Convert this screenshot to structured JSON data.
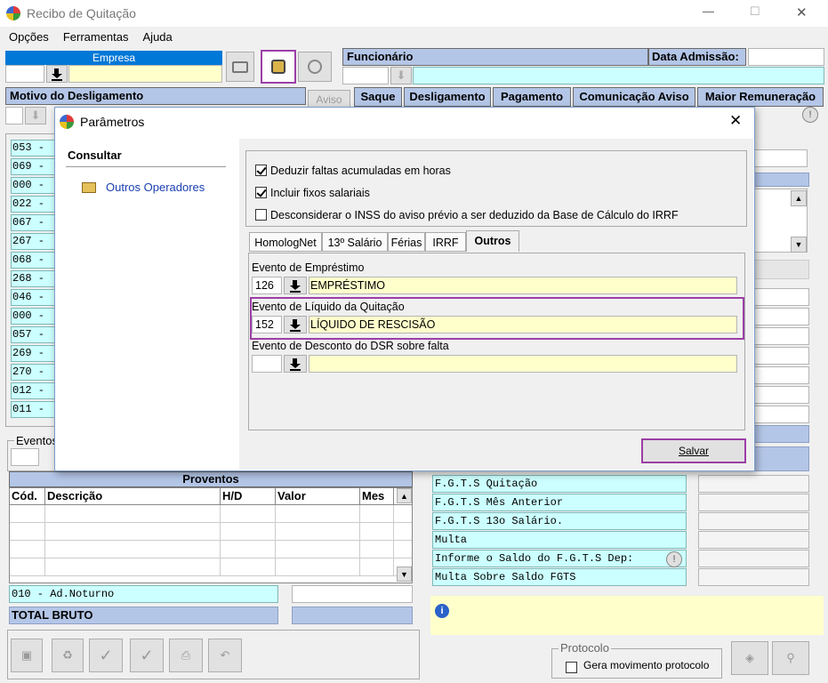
{
  "window": {
    "title": "Recibo de Quitação",
    "minimize": "—",
    "maximize": "☐",
    "close": "✕"
  },
  "menu": [
    "Opções",
    "Ferramentas",
    "Ajuda"
  ],
  "empresa": {
    "label": "Empresa"
  },
  "funcionario": {
    "label": "Funcionário",
    "admissao_label": "Data Admissão:"
  },
  "motivo": {
    "label": "Motivo do Desligamento",
    "aviso": "Aviso"
  },
  "tabs_top": [
    "Saque",
    "Desligamento",
    "Pagamento",
    "Comunicação Aviso",
    "Maior Remuneração"
  ],
  "left_codes": [
    "053 -",
    "069 -",
    "000 -",
    "022 -",
    "067 -",
    "267 -",
    "068 -",
    "268 -",
    "046 -",
    "000 -",
    "057 -",
    "269 -",
    "270 -",
    "012 -",
    "011 -"
  ],
  "eventos_label": "Eventos",
  "proventos": {
    "title": "Proventos",
    "cols": [
      "Cód.",
      "Descrição",
      "H/D",
      "Valor",
      "Mes"
    ],
    "footer_item": "010 - Ad.Noturno",
    "total": "TOTAL BRUTO"
  },
  "fgts_rows": [
    "F.G.T.S  Quitação",
    "F.G.T.S  Mês Anterior",
    "F.G.T.S  13o Salário.",
    "Multa",
    "Informe o Saldo do F.G.T.S Dep:",
    "Multa Sobre Saldo FGTS"
  ],
  "protocolo": {
    "label": "Protocolo",
    "checkbox": "Gera movimento protocolo"
  },
  "dialog": {
    "title": "Parâmetros",
    "sidebar_header": "Consultar",
    "sidebar_item": "Outros Operadores",
    "checks": [
      {
        "label": "Deduzir faltas acumuladas em horas",
        "checked": true
      },
      {
        "label": "Incluir fixos salariais",
        "checked": true
      },
      {
        "label": "Desconsiderar o INSS do aviso prévio a ser deduzido da Base de Cálculo do IRRF",
        "checked": false
      }
    ],
    "tabs": [
      "HomologNet",
      "13º Salário",
      "Férias",
      "IRRF",
      "Outros"
    ],
    "active_tab": "Outros",
    "fields": [
      {
        "label": "Evento de Empréstimo",
        "code": "126",
        "desc": "EMPRÉSTIMO"
      },
      {
        "label": "Evento de Líquido da Quitação",
        "code": "152",
        "desc": "LÍQUIDO DE RESCISÃO"
      },
      {
        "label": "Evento de Desconto do DSR sobre falta",
        "code": "",
        "desc": ""
      }
    ],
    "save": "Salvar"
  }
}
